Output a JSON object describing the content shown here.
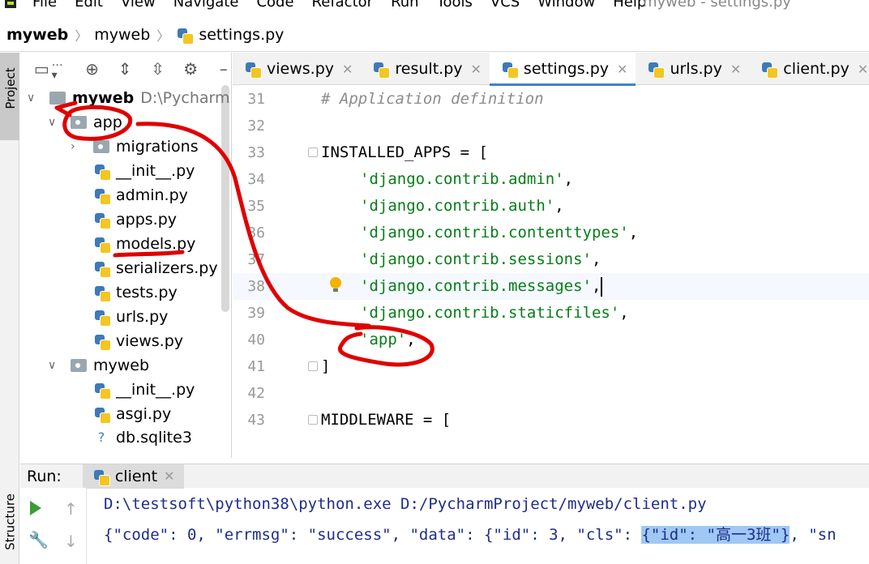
{
  "menubar": {
    "items": [
      "File",
      "Edit",
      "View",
      "Navigate",
      "Code",
      "Refactor",
      "Run",
      "Tools",
      "VCS",
      "Window",
      "Help"
    ],
    "window_title": "myweb - settings.py"
  },
  "breadcrumb": [
    "myweb",
    "myweb",
    "settings.py"
  ],
  "side_tabs": {
    "project": "Project",
    "structure": "Structure"
  },
  "project_tree": {
    "root": {
      "name": "myweb",
      "path": "D:\\PycharmProject\\myweb"
    },
    "rows": [
      {
        "name": "app"
      },
      {
        "name": "migrations"
      },
      {
        "name": "__init__.py"
      },
      {
        "name": "admin.py"
      },
      {
        "name": "apps.py"
      },
      {
        "name": "models.py"
      },
      {
        "name": "serializers.py"
      },
      {
        "name": "tests.py"
      },
      {
        "name": "urls.py"
      },
      {
        "name": "views.py"
      },
      {
        "name": "myweb"
      },
      {
        "name": "__init__.py"
      },
      {
        "name": "asgi.py"
      },
      {
        "name": "db.sqlite3"
      }
    ]
  },
  "tabs": [
    {
      "label": "views.py"
    },
    {
      "label": "result.py"
    },
    {
      "label": "settings.py",
      "active": true
    },
    {
      "label": "urls.py"
    },
    {
      "label": "client.py"
    }
  ],
  "editor": {
    "lines": [
      {
        "no": "31",
        "text": "# Application definition"
      },
      {
        "no": "32",
        "text": ""
      },
      {
        "no": "33",
        "text": "INSTALLED_APPS = ["
      },
      {
        "no": "34",
        "text": "'django.contrib.admin'",
        "suffix": ","
      },
      {
        "no": "35",
        "text": "'django.contrib.auth'",
        "suffix": ","
      },
      {
        "no": "36",
        "text": "'django.contrib.contenttypes'",
        "suffix": ","
      },
      {
        "no": "37",
        "text": "'django.contrib.sessions'",
        "suffix": ","
      },
      {
        "no": "38",
        "text": "'django.contrib.messages'",
        "suffix": ","
      },
      {
        "no": "39",
        "text": "'django.contrib.staticfiles'",
        "suffix": ","
      },
      {
        "no": "40",
        "text": "'app'",
        "suffix": ","
      },
      {
        "no": "41",
        "text": "]"
      },
      {
        "no": "42",
        "text": ""
      },
      {
        "no": "43",
        "text": "MIDDLEWARE = ["
      }
    ]
  },
  "run_panel": {
    "label": "Run:",
    "tab": "client",
    "console": {
      "line1": "D:\\testsoft\\python38\\python.exe D:/PycharmProject/myweb/client.py",
      "line2_prefix": "{\"code\": 0, \"errmsg\": \"success\", \"data\": {\"id\": 3, \"cls\": ",
      "line2_highlight": "{\"id\": \"高一3班\"}",
      "line2_suffix": ", \"sn"
    }
  },
  "colors": {
    "accent": "#4083c9",
    "string": "#067d17",
    "annotation": "#e00000",
    "highlight": "#9fc8f4"
  }
}
